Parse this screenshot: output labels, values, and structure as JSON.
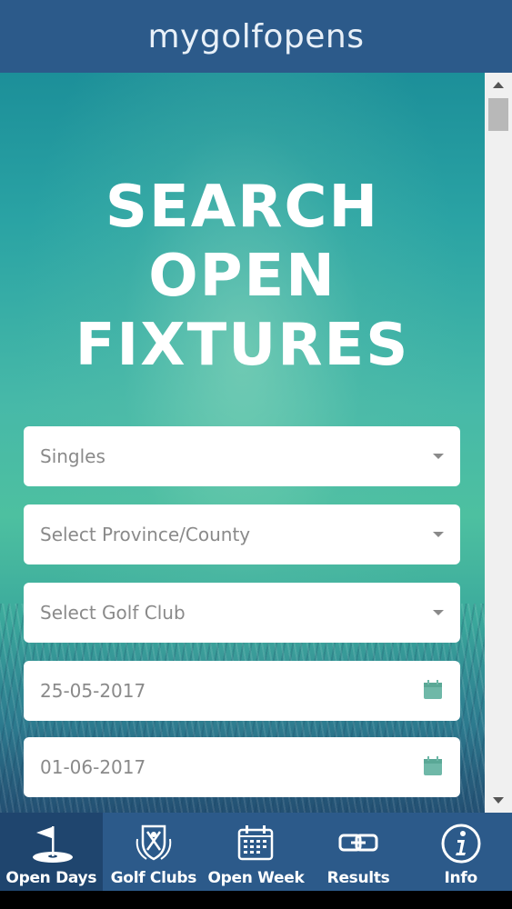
{
  "header": {
    "logo_text": "mygolfopens"
  },
  "hero": {
    "title_lines": [
      "SEARCH",
      "OPEN",
      "FIXTURES"
    ]
  },
  "form": {
    "type_select": {
      "value": "Singles"
    },
    "province_select": {
      "placeholder": "Select Province/County"
    },
    "club_select": {
      "placeholder": "Select Golf Club"
    },
    "date_from": {
      "value": "25-05-2017"
    },
    "date_to": {
      "value": "01-06-2017"
    }
  },
  "nav": {
    "items": [
      {
        "label": "Open Days",
        "icon": "golf-flag-icon",
        "active": true
      },
      {
        "label": "Golf Clubs",
        "icon": "crest-icon",
        "active": false
      },
      {
        "label": "Open Week",
        "icon": "calendar-icon",
        "active": false
      },
      {
        "label": "Results",
        "icon": "link-icon",
        "active": false
      },
      {
        "label": "Info",
        "icon": "info-icon",
        "active": false
      }
    ]
  },
  "colors": {
    "header_bg": "#2c5a8a",
    "nav_active_bg": "#1f456e",
    "field_text": "#8a8a8a",
    "calendar_icon": "#6fb8a8"
  }
}
